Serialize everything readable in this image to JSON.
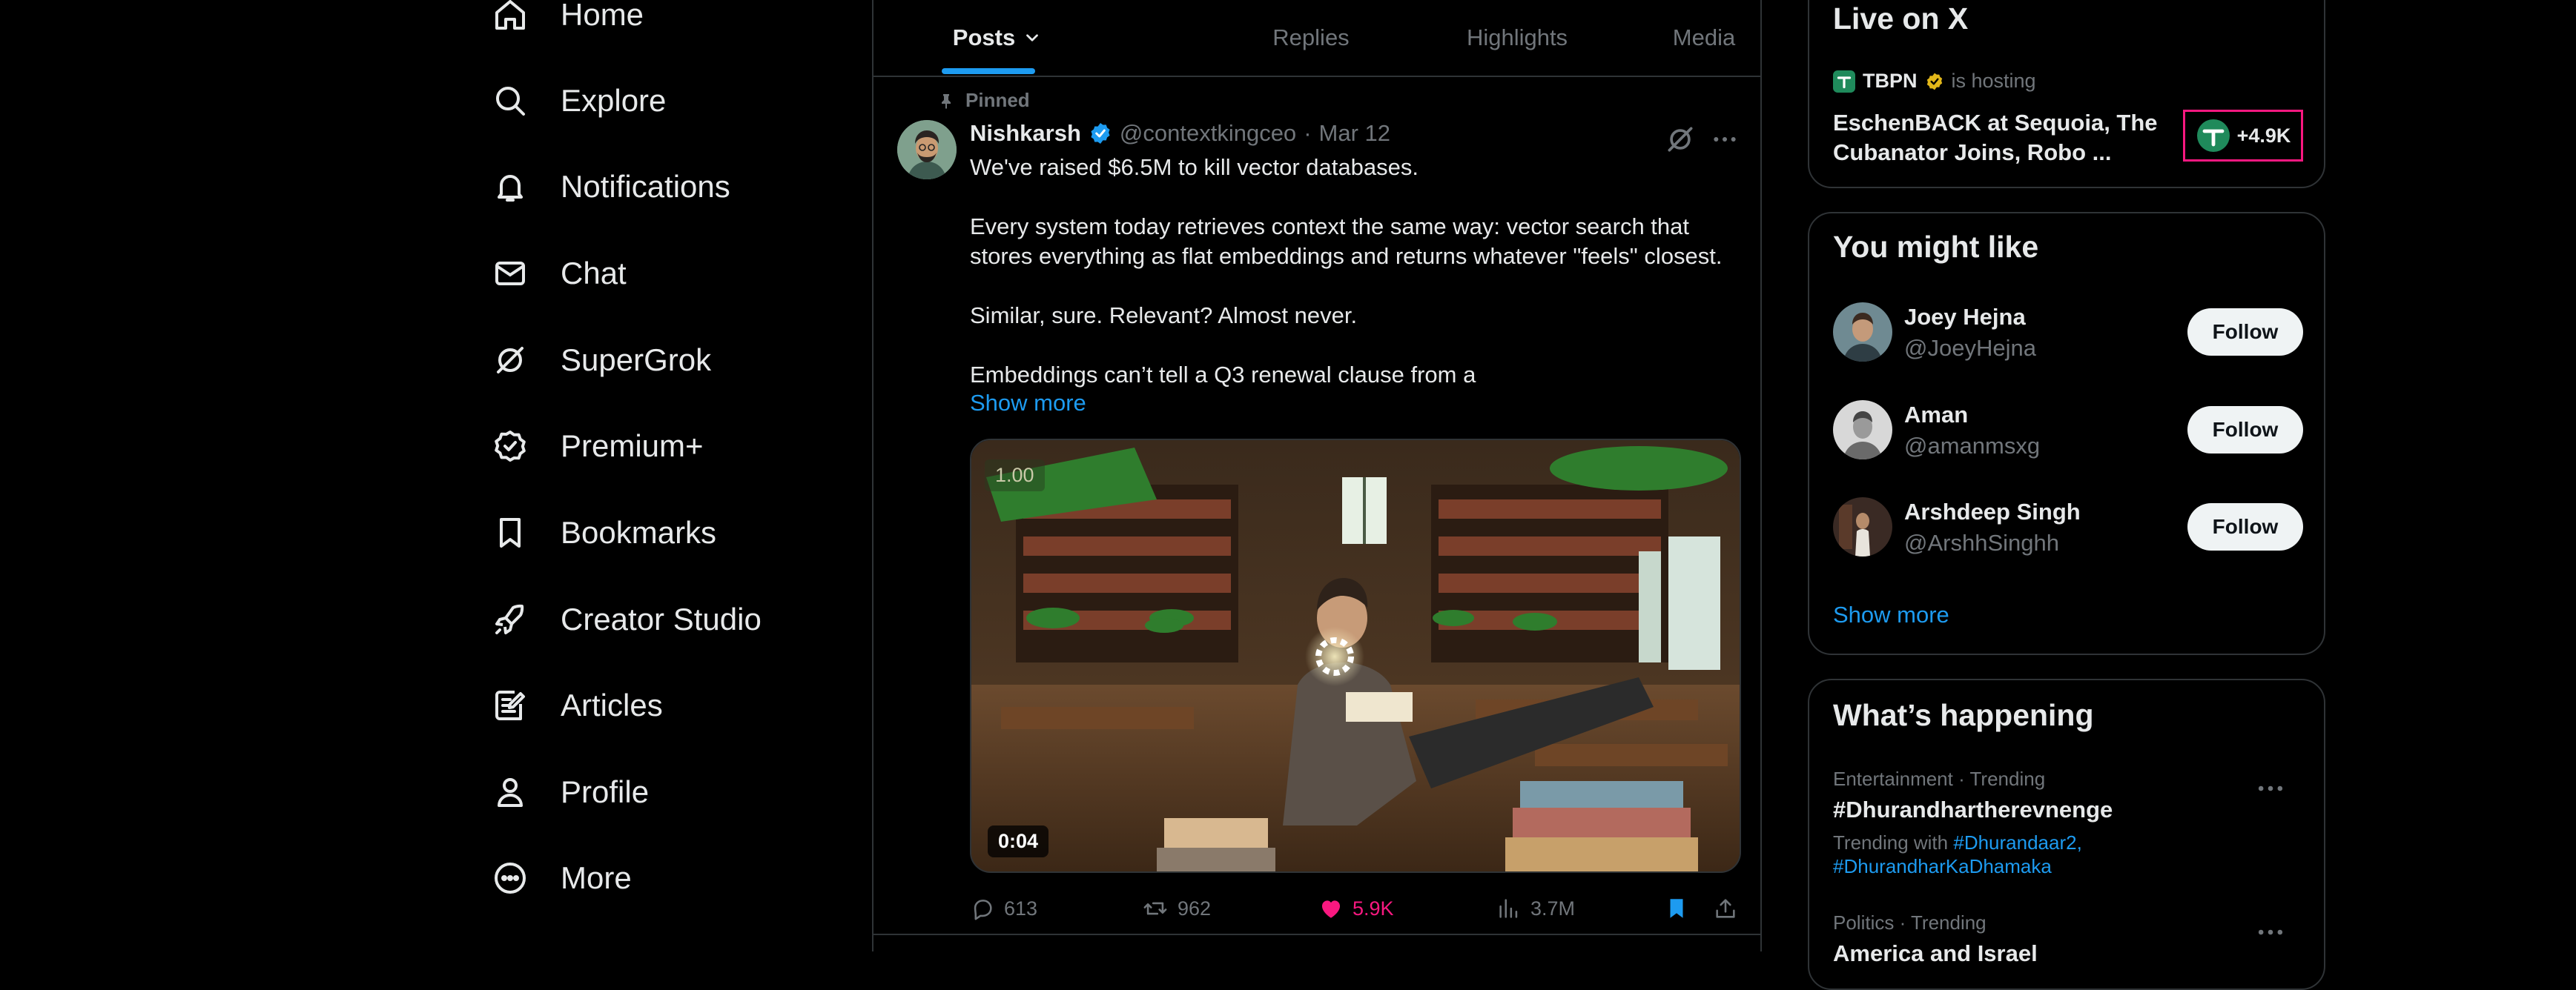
{
  "nav": {
    "items": [
      {
        "label": "Home",
        "icon": "home-icon"
      },
      {
        "label": "Explore",
        "icon": "search-icon"
      },
      {
        "label": "Notifications",
        "icon": "bell-icon"
      },
      {
        "label": "Chat",
        "icon": "mail-icon"
      },
      {
        "label": "SuperGrok",
        "icon": "grok-icon"
      },
      {
        "label": "Premium+",
        "icon": "verified-badge-icon"
      },
      {
        "label": "Bookmarks",
        "icon": "bookmark-icon"
      },
      {
        "label": "Creator Studio",
        "icon": "rocket-icon"
      },
      {
        "label": "Articles",
        "icon": "article-icon"
      },
      {
        "label": "Profile",
        "icon": "person-icon"
      },
      {
        "label": "More",
        "icon": "more-circle-icon"
      }
    ]
  },
  "tabs": [
    {
      "label": "Posts",
      "active": true
    },
    {
      "label": "Replies"
    },
    {
      "label": "Highlights"
    },
    {
      "label": "Media"
    }
  ],
  "post": {
    "pinned_label": "Pinned",
    "author": "Nishkarsh",
    "handle": "@contextkingceo",
    "separator": "·",
    "date": "Mar 12",
    "lines": [
      "We've raised $6.5M to kill vector databases.",
      "",
      "Every system today retrieves context the same way: vector search that",
      "stores everything as flat embeddings and returns whatever \"feels\" closest.",
      "",
      "Similar, sure. Relevant? Almost never.",
      "",
      "Embeddings can’t tell a Q3 renewal clause from a"
    ],
    "show_more": "Show more",
    "media": {
      "speed": "1.00",
      "duration": "0:04"
    },
    "actions": {
      "replies": "613",
      "reposts": "962",
      "likes": "5.9K",
      "views": "3.7M"
    }
  },
  "live": {
    "title": "Live on X",
    "host": "TBPN",
    "status": "is hosting",
    "space_title": "EschenBACK at Sequoia, The Cubanator Joins, Robo ...",
    "listeners": "+4.9K"
  },
  "who_to_follow": {
    "title": "You might like",
    "users": [
      {
        "name": "Joey Hejna",
        "handle": "@JoeyHejna",
        "button": "Follow"
      },
      {
        "name": "Aman",
        "handle": "@amanmsxg",
        "button": "Follow"
      },
      {
        "name": "Arshdeep Singh",
        "handle": "@ArshhSinghh",
        "button": "Follow"
      }
    ],
    "show_more": "Show more"
  },
  "trends": {
    "title": "What’s happening",
    "items": [
      {
        "meta": "Entertainment · Trending",
        "name": "#Dhurandhartherevnenge",
        "with_label": "Trending with",
        "with_tags": [
          "#Dhurandaar2,",
          "#DhurandharKaDhamaka"
        ]
      },
      {
        "meta": "Politics · Trending",
        "name": "America and Israel"
      }
    ]
  },
  "colors": {
    "background": "#000000",
    "accent": "#1d9bf0",
    "like": "#f91880",
    "border": "#2f3336",
    "verified": "#1d9bf0",
    "gold_badge": "#e2b719"
  }
}
